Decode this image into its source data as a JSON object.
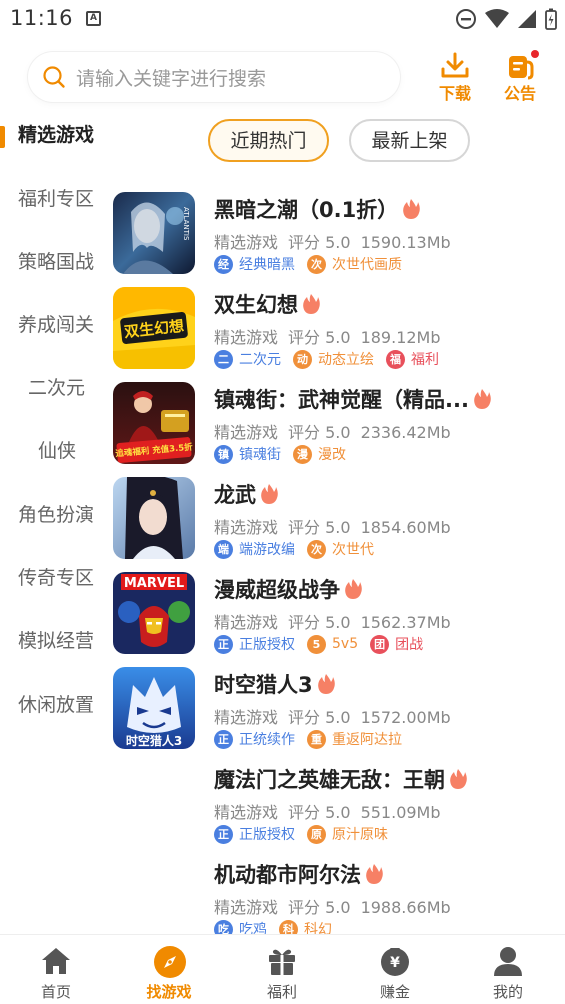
{
  "status_bar": {
    "time": "11:16",
    "a_label": "A"
  },
  "search": {
    "placeholder": "请输入关键字进行搜索"
  },
  "header": {
    "download_label": "下载",
    "notice_label": "公告"
  },
  "sidebar": {
    "items": [
      {
        "label": "精选游戏",
        "active": true
      },
      {
        "label": "福利专区"
      },
      {
        "label": "策略国战"
      },
      {
        "label": "养成闯关"
      },
      {
        "label": "二次元"
      },
      {
        "label": "仙侠"
      },
      {
        "label": "角色扮演"
      },
      {
        "label": "传奇专区"
      },
      {
        "label": "模拟经营"
      },
      {
        "label": "休闲放置"
      }
    ]
  },
  "tabs": [
    {
      "label": "近期热门",
      "active": true
    },
    {
      "label": "最新上架"
    }
  ],
  "games": [
    {
      "title": "黑暗之潮（0.1折）",
      "category": "精选游戏",
      "rating": "评分 5.0",
      "size": "1590.13Mb",
      "tags": [
        {
          "badge": "经",
          "text": "经典暗黑",
          "color": "#4a7fe0"
        },
        {
          "badge": "次",
          "text": "次世代画质",
          "color": "#f0903a"
        }
      ]
    },
    {
      "title": "双生幻想",
      "category": "精选游戏",
      "rating": "评分 5.0",
      "size": "189.12Mb",
      "tags": [
        {
          "badge": "二",
          "text": "二次元",
          "color": "#4a7fe0"
        },
        {
          "badge": "动",
          "text": "动态立绘",
          "color": "#f0903a"
        },
        {
          "badge": "福",
          "text": "福利",
          "color": "#e8505b"
        }
      ]
    },
    {
      "title": "镇魂街：武神觉醒（精品...",
      "category": "精选游戏",
      "rating": "评分 5.0",
      "size": "2336.42Mb",
      "tags": [
        {
          "badge": "镇",
          "text": "镇魂街",
          "color": "#4a7fe0"
        },
        {
          "badge": "漫",
          "text": "漫改",
          "color": "#f0903a"
        }
      ]
    },
    {
      "title": "龙武",
      "category": "精选游戏",
      "rating": "评分 5.0",
      "size": "1854.60Mb",
      "tags": [
        {
          "badge": "端",
          "text": "端游改编",
          "color": "#4a7fe0"
        },
        {
          "badge": "次",
          "text": "次世代",
          "color": "#f0903a"
        }
      ]
    },
    {
      "title": "漫威超级战争",
      "category": "精选游戏",
      "rating": "评分 5.0",
      "size": "1562.37Mb",
      "tags": [
        {
          "badge": "正",
          "text": "正版授权",
          "color": "#4a7fe0"
        },
        {
          "badge": "5",
          "text": "5v5",
          "color": "#f0903a"
        },
        {
          "badge": "团",
          "text": "团战",
          "color": "#e8505b"
        }
      ]
    },
    {
      "title": "时空猎人3",
      "category": "精选游戏",
      "rating": "评分 5.0",
      "size": "1572.00Mb",
      "tags": [
        {
          "badge": "正",
          "text": "正统续作",
          "color": "#4a7fe0"
        },
        {
          "badge": "重",
          "text": "重返阿达拉",
          "color": "#f0903a"
        }
      ]
    },
    {
      "title": "魔法门之英雄无敌：王朝",
      "category": "精选游戏",
      "rating": "评分 5.0",
      "size": "551.09Mb",
      "tags": [
        {
          "badge": "正",
          "text": "正版授权",
          "color": "#4a7fe0"
        },
        {
          "badge": "原",
          "text": "原汁原味",
          "color": "#f0903a"
        }
      ]
    },
    {
      "title": "机动都市阿尔法",
      "category": "精选游戏",
      "rating": "评分 5.0",
      "size": "1988.66Mb",
      "tags": [
        {
          "badge": "吃",
          "text": "吃鸡",
          "color": "#4a7fe0"
        },
        {
          "badge": "科",
          "text": "科幻",
          "color": "#f0903a"
        }
      ]
    }
  ],
  "game_icon_text": {
    "dark_tide": "ATLANTIS",
    "twin_fantasy": "双生幻想",
    "zhenhunjie": "追魂福利 充值3.5折",
    "marvel": "MARVEL",
    "hunter3": "时空猎人3"
  },
  "bottom_nav": [
    {
      "label": "首页",
      "icon": "home-icon"
    },
    {
      "label": "找游戏",
      "icon": "compass-icon",
      "active": true
    },
    {
      "label": "福利",
      "icon": "gift-icon"
    },
    {
      "label": "赚金",
      "icon": "coin-bag-icon"
    },
    {
      "label": "我的",
      "icon": "user-icon"
    }
  ],
  "colors": {
    "accent": "#f08a00",
    "blue_tag": "#4a7fe0",
    "orange_tag": "#f0903a",
    "red_tag": "#e8505b",
    "fire": "#f56a4a"
  }
}
